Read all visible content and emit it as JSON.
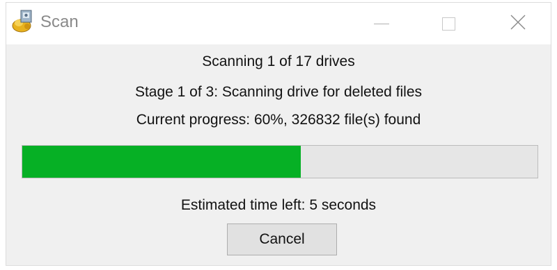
{
  "window": {
    "title": "Scan",
    "icon": "scan-app-icon",
    "controls": {
      "minimize": "minimize-icon",
      "maximize": "maximize-icon",
      "close": "close-icon"
    }
  },
  "status": {
    "drives_line": "Scanning 1 of 17 drives",
    "stage_line": "Stage 1 of 3: Scanning drive for deleted files",
    "progress_line": "Current progress: 60%, 326832 file(s) found",
    "time_left_line": "Estimated time left: 5 seconds"
  },
  "progress": {
    "percent": 54,
    "fill_color": "#06b025"
  },
  "buttons": {
    "cancel_label": "Cancel"
  }
}
